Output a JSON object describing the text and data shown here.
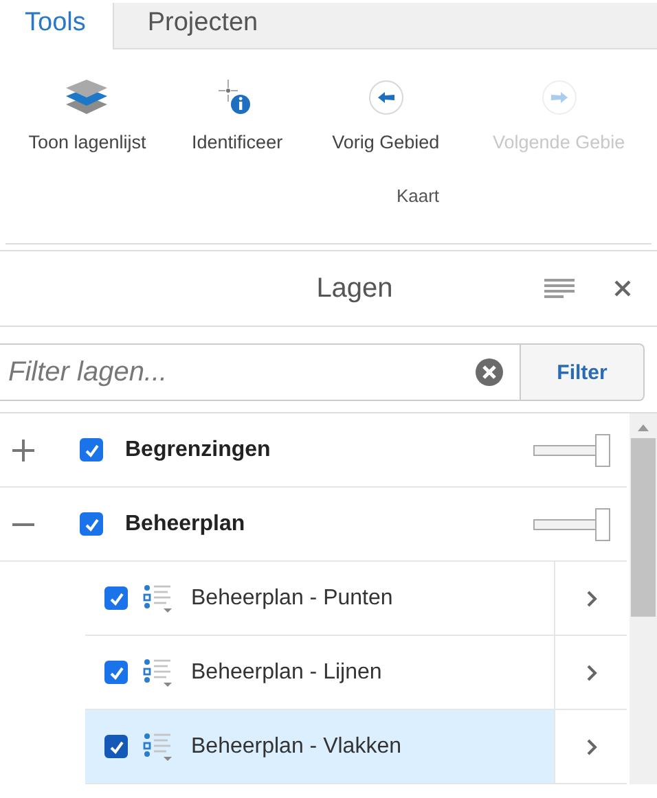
{
  "tabs": [
    {
      "label": "Tools",
      "selected": true
    },
    {
      "label": "Projecten",
      "selected": false
    }
  ],
  "ribbon": {
    "buttons": [
      {
        "kind": "layers",
        "label": "Toon lagenlijst",
        "disabled": false
      },
      {
        "kind": "identify",
        "label": "Identificeer",
        "disabled": false
      },
      {
        "kind": "back",
        "label": "Vorig Gebied",
        "disabled": false
      },
      {
        "kind": "forward",
        "label": "Volgende Gebie",
        "disabled": true
      }
    ],
    "group_label": "Kaart"
  },
  "panel": {
    "title": "Lagen",
    "filter": {
      "placeholder": "Filter lagen...",
      "button": "Filter"
    },
    "layers": [
      {
        "name": "Begrenzingen",
        "checked": true,
        "expanded": false,
        "level": 1
      },
      {
        "name": "Beheerplan",
        "checked": true,
        "expanded": true,
        "level": 1,
        "children": [
          {
            "name": "Beheerplan - Punten",
            "checked": true,
            "selected": false
          },
          {
            "name": "Beheerplan - Lijnen",
            "checked": true,
            "selected": false
          },
          {
            "name": "Beheerplan - Vlakken",
            "checked": true,
            "selected": true
          }
        ]
      }
    ]
  }
}
